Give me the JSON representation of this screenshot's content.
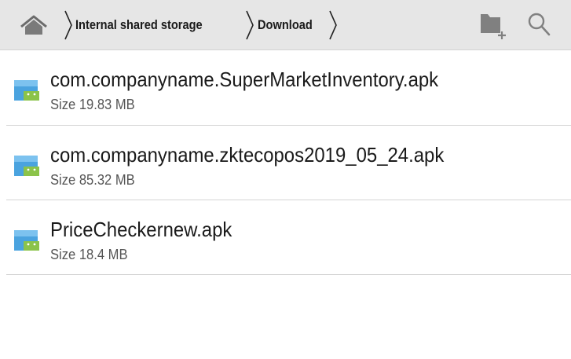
{
  "toolbar": {
    "home_icon": "home-icon",
    "breadcrumbs": [
      {
        "label": "Internal shared storage"
      },
      {
        "label": "Download"
      }
    ],
    "new_folder_icon": "new-folder-icon",
    "search_icon": "search-icon"
  },
  "files": [
    {
      "name": "com.companyname.SuperMarketInventory.apk",
      "size": "Size 19.83 MB",
      "icon": "apk-file-icon"
    },
    {
      "name": "com.companyname.zktecopos2019_05_24.apk",
      "size": "Size 85.32 MB",
      "icon": "apk-file-icon"
    },
    {
      "name": "PriceCheckernew.apk",
      "size": "Size 18.4 MB",
      "icon": "apk-file-icon"
    }
  ],
  "colors": {
    "toolbar_bg": "#e6e6e6",
    "divider": "#d4d4d4",
    "android_green": "#8bc34a",
    "apk_blue": "#4aa3df"
  }
}
